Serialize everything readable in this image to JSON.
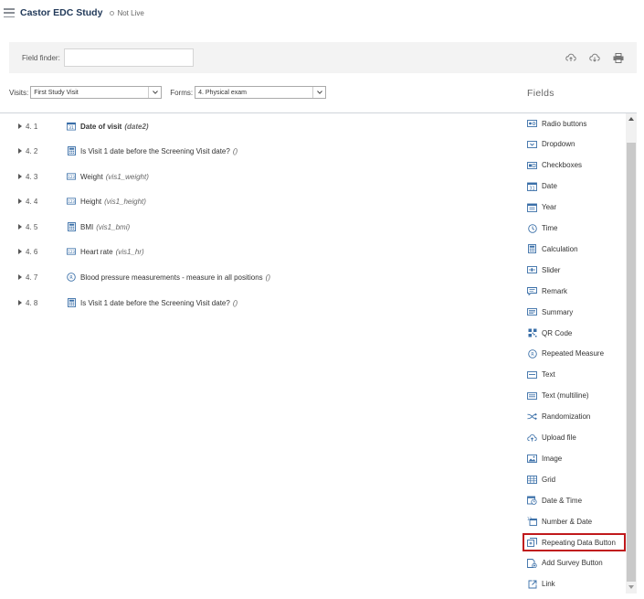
{
  "header": {
    "app_title": "Castor EDC Study",
    "status": "Not Live"
  },
  "finder": {
    "label": "Field finder:",
    "value": "",
    "icons": [
      "upload-cloud-icon",
      "download-cloud-icon",
      "print-icon"
    ]
  },
  "selectors": {
    "visits_label": "Visits:",
    "visits_value": "First Study Visit",
    "forms_label": "Forms:",
    "forms_value": "4. Physical exam"
  },
  "fields_title": "Fields",
  "form_fields": [
    {
      "num": "4. 1",
      "label": "Date of visit",
      "var": "(date2)",
      "icon": "calendar-icon",
      "bold": true
    },
    {
      "num": "4. 2",
      "label": "Is Visit 1 date before the Screening Visit date?",
      "var": "()",
      "icon": "calculator-icon",
      "bold": false
    },
    {
      "num": "4. 3",
      "label": "Weight",
      "var": "(vis1_weight)",
      "icon": "numeric-icon",
      "bold": false
    },
    {
      "num": "4. 4",
      "label": "Height",
      "var": "(vis1_height)",
      "icon": "numeric-icon",
      "bold": false
    },
    {
      "num": "4. 5",
      "label": "BMI",
      "var": "(vis1_bmi)",
      "icon": "calculator-icon",
      "bold": false
    },
    {
      "num": "4. 6",
      "label": "Heart rate",
      "var": "(vis1_hr)",
      "icon": "numeric-icon",
      "bold": false
    },
    {
      "num": "4. 7",
      "label": "Blood pressure measurements - measure in all positions",
      "var": "()",
      "icon": "repeated-measure-icon",
      "bold": false
    },
    {
      "num": "4. 8",
      "label": "Is Visit 1 date before the Screening Visit date?",
      "var": "()",
      "icon": "calculator-icon",
      "bold": false
    }
  ],
  "palette": [
    {
      "label": "Radio buttons",
      "icon": "radio-icon"
    },
    {
      "label": "Dropdown",
      "icon": "dropdown-icon"
    },
    {
      "label": "Checkboxes",
      "icon": "checkbox-icon"
    },
    {
      "label": "Date",
      "icon": "calendar-icon"
    },
    {
      "label": "Year",
      "icon": "year-icon"
    },
    {
      "label": "Time",
      "icon": "clock-icon"
    },
    {
      "label": "Calculation",
      "icon": "calculator-icon"
    },
    {
      "label": "Slider",
      "icon": "slider-icon"
    },
    {
      "label": "Remark",
      "icon": "remark-icon"
    },
    {
      "label": "Summary",
      "icon": "summary-icon"
    },
    {
      "label": "QR Code",
      "icon": "qr-code-icon"
    },
    {
      "label": "Repeated Measure",
      "icon": "repeated-measure-icon"
    },
    {
      "label": "Text",
      "icon": "text-icon"
    },
    {
      "label": "Text (multiline)",
      "icon": "text-multiline-icon"
    },
    {
      "label": "Randomization",
      "icon": "randomization-icon"
    },
    {
      "label": "Upload file",
      "icon": "upload-cloud-icon"
    },
    {
      "label": "Image",
      "icon": "image-icon"
    },
    {
      "label": "Grid",
      "icon": "grid-icon"
    },
    {
      "label": "Date & Time",
      "icon": "date-time-icon"
    },
    {
      "label": "Number & Date",
      "icon": "number-date-icon"
    },
    {
      "label": "Repeating Data Button",
      "icon": "repeating-data-icon",
      "highlighted": true
    },
    {
      "label": "Add Survey Button",
      "icon": "survey-icon"
    },
    {
      "label": "Link",
      "icon": "link-icon"
    }
  ],
  "colors": {
    "icon_blue": "#3a6fa8",
    "highlight": "#c0191c",
    "title": "#223a5a"
  }
}
